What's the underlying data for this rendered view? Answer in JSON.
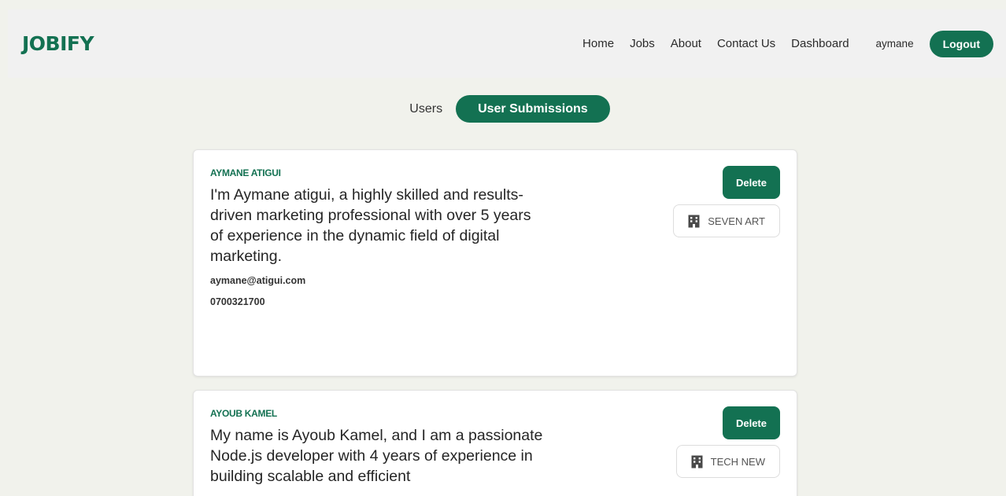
{
  "navbar": {
    "brand": "JOBIFY",
    "links": [
      "Home",
      "Jobs",
      "About",
      "Contact Us",
      "Dashboard"
    ],
    "username": "aymane",
    "logout_label": "Logout"
  },
  "tabs": {
    "users": "Users",
    "submissions": "User Submissions",
    "active": "User Submissions"
  },
  "submissions": [
    {
      "name": "AYMANE ATIGUI",
      "description": "I'm Aymane atigui, a highly skilled and results-driven marketing professional with over 5 years of experience in the dynamic field of digital marketing.",
      "email": "aymane@atigui.com",
      "phone": "0700321700",
      "delete_label": "Delete",
      "company": "SEVEN ART"
    },
    {
      "name": "AYOUB KAMEL",
      "description": "My name is Ayoub Kamel, and I am a passionate Node.js developer with 4 years of experience in building scalable and efficient",
      "email": "",
      "phone": "",
      "delete_label": "Delete",
      "company": "TECH NEW"
    }
  ],
  "colors": {
    "accent": "#137152",
    "background": "#f1f2ec",
    "navbar": "#f1f1f1"
  },
  "icons": {
    "company": "building-icon"
  }
}
